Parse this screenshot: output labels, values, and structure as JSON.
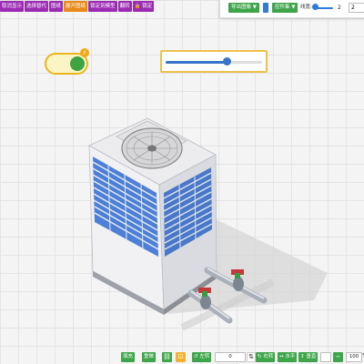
{
  "toolbar_left": {
    "buttons": [
      {
        "label": "取消显示",
        "color": "purple"
      },
      {
        "label": "选择替代",
        "color": "purple"
      },
      {
        "label": "图纸",
        "color": "purple"
      },
      {
        "label": "展开图纸",
        "color": "orange"
      },
      {
        "label": "锁定到模型",
        "color": "purple"
      },
      {
        "label": "翻转",
        "color": "purple"
      },
      {
        "label": "🔒 锁定",
        "color": "purple"
      }
    ]
  },
  "toolbar_right": {
    "export_label": "导出图像 ▼",
    "control_label": "控件集 ▼",
    "line_width_label": "线宽:",
    "line_width_value": "2",
    "line_width_input": "2"
  },
  "toggle": {
    "state": "on",
    "badge_icon": "⚡"
  },
  "main_slider": {
    "value_fraction": 0.65
  },
  "bottom_toolbar": {
    "btn_fill_label": "填充",
    "btn_repeat_label": "重做",
    "rotate_left_label": "↺ 左转",
    "rotate_left_value": "0",
    "rotate_right_label": "↻ 右转",
    "flip_h_label": "↔ 水平",
    "flip_v_label": "↕ 垂直",
    "extra_value": "",
    "zoom_value": "100",
    "zoom_unit": "%"
  },
  "colors": {
    "accent_green": "#3ea54a",
    "accent_purple": "#9b2bb3",
    "accent_orange": "#e8891a",
    "accent_blue": "#2e7bd8"
  }
}
